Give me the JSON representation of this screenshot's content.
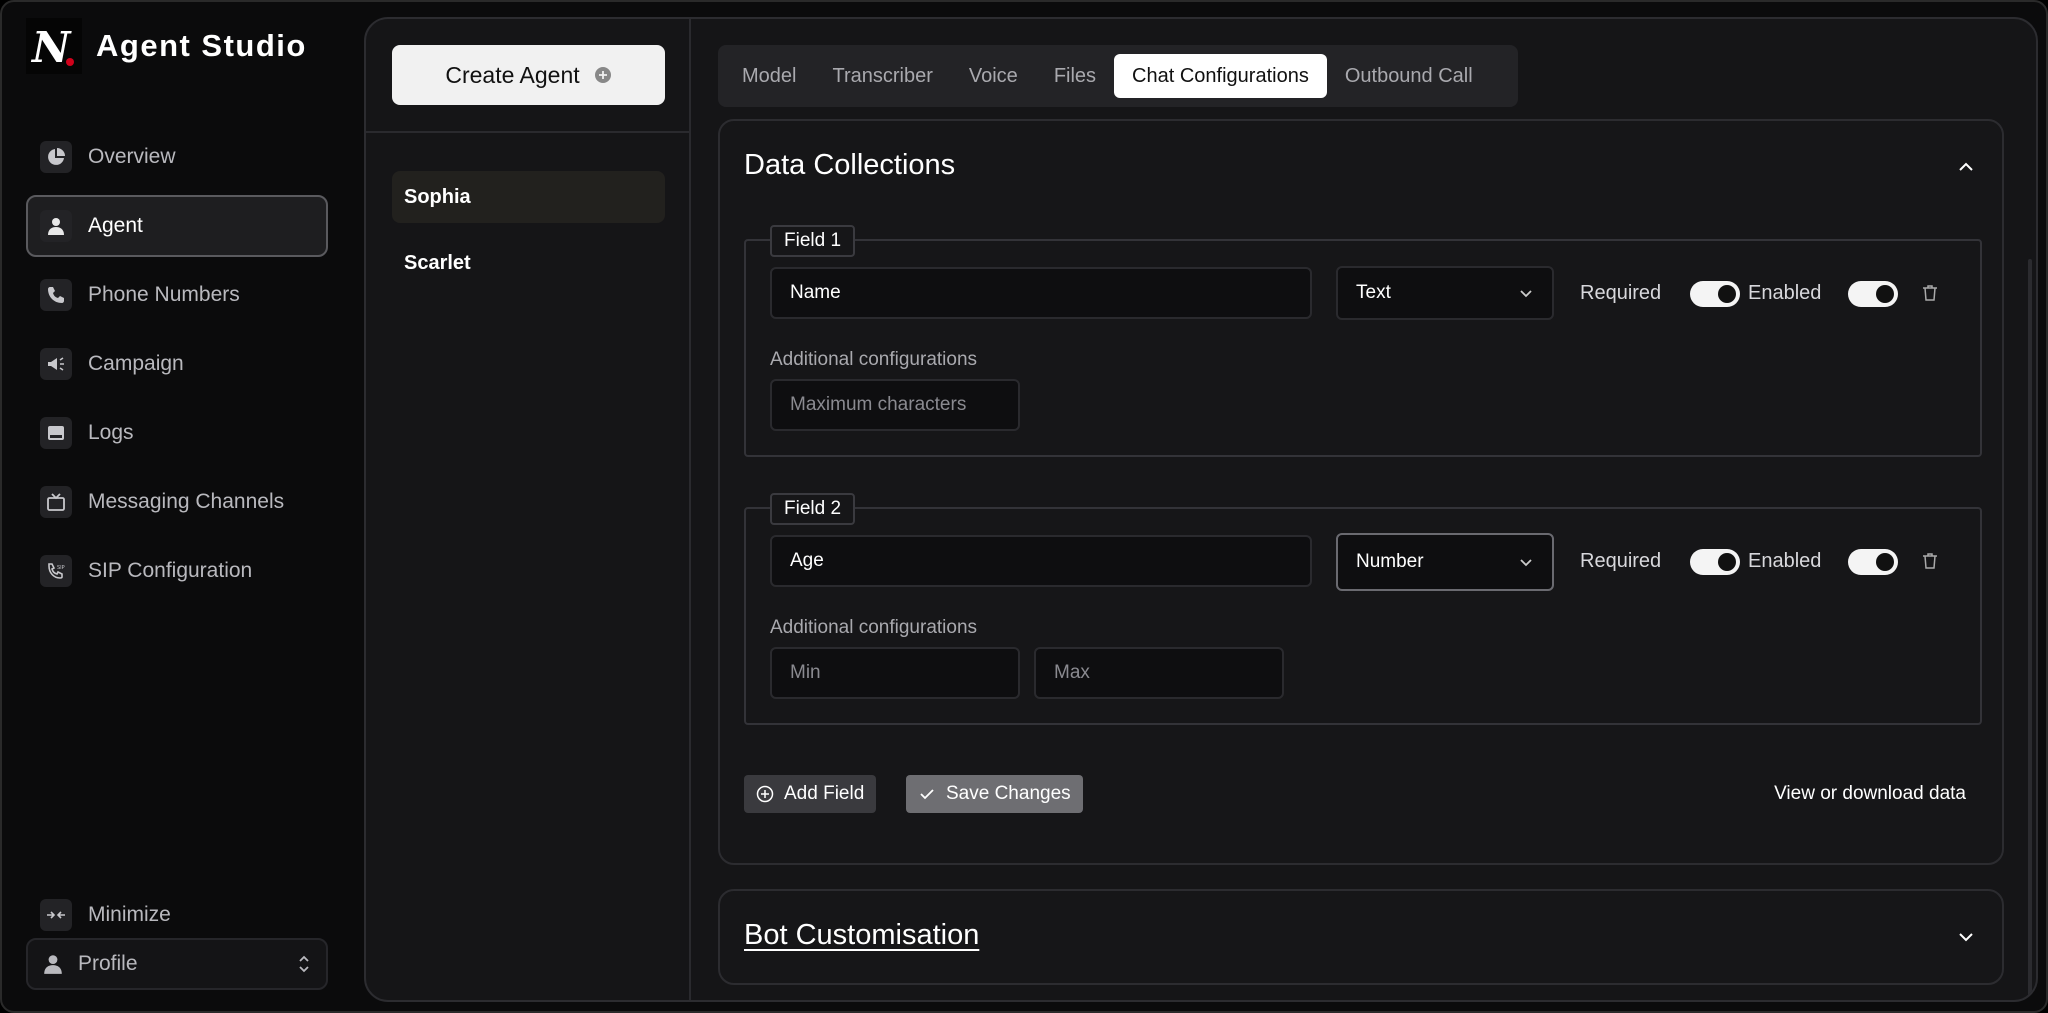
{
  "brand": {
    "name": "Agent Studio",
    "logo_letter": "N"
  },
  "sidebar": {
    "items": [
      {
        "label": "Overview",
        "icon": "pie-chart-icon"
      },
      {
        "label": "Agent",
        "icon": "user-icon",
        "active": true
      },
      {
        "label": "Phone Numbers",
        "icon": "phone-icon"
      },
      {
        "label": "Campaign",
        "icon": "megaphone-icon"
      },
      {
        "label": "Logs",
        "icon": "logs-icon"
      },
      {
        "label": "Messaging Channels",
        "icon": "tv-icon"
      },
      {
        "label": "SIP Configuration",
        "icon": "sip-phone-icon"
      }
    ],
    "minimize_label": "Minimize",
    "profile_label": "Profile"
  },
  "agents": {
    "create_label": "Create Agent",
    "list": [
      "Sophia",
      "Scarlet"
    ],
    "selected": "Sophia"
  },
  "tabs": {
    "items": [
      "Model",
      "Transcriber",
      "Voice",
      "Files",
      "Chat Configurations",
      "Outbound Call"
    ],
    "active": "Chat Configurations"
  },
  "data_collections": {
    "title": "Data Collections",
    "fields": [
      {
        "legend": "Field 1",
        "name_value": "Name",
        "type_value": "Text",
        "required_label": "Required",
        "required_on": true,
        "enabled_label": "Enabled",
        "enabled_on": true,
        "config_label": "Additional configurations",
        "config_placeholders": [
          "Maximum characters"
        ]
      },
      {
        "legend": "Field 2",
        "name_value": "Age",
        "type_value": "Number",
        "required_label": "Required",
        "required_on": true,
        "enabled_label": "Enabled",
        "enabled_on": true,
        "config_label": "Additional configurations",
        "config_placeholders": [
          "Min",
          "Max"
        ]
      }
    ],
    "add_field_label": "Add Field",
    "save_label": "Save Changes",
    "view_link_label": "View or download data"
  },
  "bot_customisation": {
    "title": "Bot Customisation"
  },
  "colors": {
    "background": "#0b0b0c",
    "panel": "#151517",
    "accent": "#ffffff",
    "toggle_on": "#f4f4f4",
    "logo_dot": "#d0021b"
  }
}
